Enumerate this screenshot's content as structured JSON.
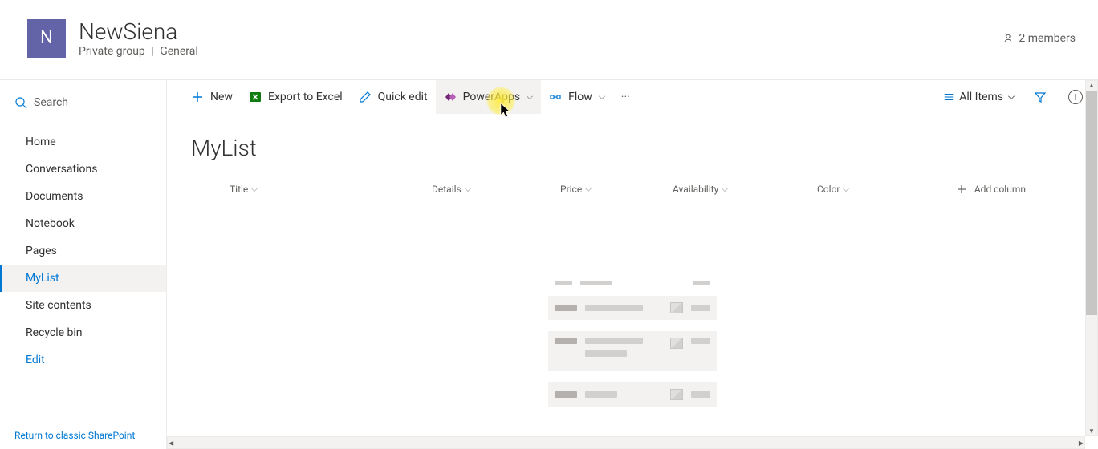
{
  "header": {
    "logo_letter": "N",
    "title": "NewSiena",
    "group_type": "Private group",
    "classification": "General",
    "members_label": "2 members"
  },
  "search": {
    "placeholder": "Search"
  },
  "nav": {
    "items": [
      {
        "label": "Home"
      },
      {
        "label": "Conversations"
      },
      {
        "label": "Documents"
      },
      {
        "label": "Notebook"
      },
      {
        "label": "Pages"
      },
      {
        "label": "MyList",
        "active": true
      },
      {
        "label": "Site contents"
      },
      {
        "label": "Recycle bin"
      },
      {
        "label": "Edit",
        "link": true
      }
    ],
    "return_link": "Return to classic SharePoint"
  },
  "commands": {
    "new": "New",
    "export": "Export to Excel",
    "quick_edit": "Quick edit",
    "powerapps": "PowerApps",
    "flow": "Flow"
  },
  "view": {
    "current": "All Items"
  },
  "list": {
    "title": "MyList",
    "columns": {
      "title": "Title",
      "details": "Details",
      "price": "Price",
      "availability": "Availability",
      "color": "Color",
      "add": "Add column"
    }
  }
}
